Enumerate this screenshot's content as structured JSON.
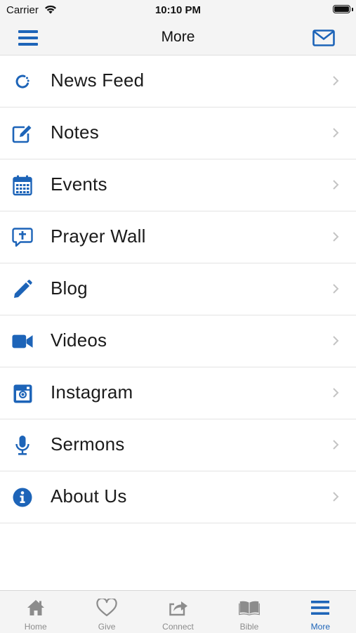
{
  "status_bar": {
    "carrier": "Carrier",
    "time": "10:10 PM"
  },
  "nav": {
    "title": "More",
    "menu_icon": "hamburger-menu-icon",
    "mail_icon": "envelope-icon"
  },
  "colors": {
    "accent": "#1d64b8",
    "tab_inactive": "#8c8c8c",
    "chevron": "#c4c4c4"
  },
  "menu_items": [
    {
      "label": "News Feed",
      "icon": "refresh-icon"
    },
    {
      "label": "Notes",
      "icon": "edit-note-icon"
    },
    {
      "label": "Events",
      "icon": "calendar-icon"
    },
    {
      "label": "Prayer Wall",
      "icon": "chat-cross-icon"
    },
    {
      "label": "Blog",
      "icon": "pencil-icon"
    },
    {
      "label": "Videos",
      "icon": "video-camera-icon"
    },
    {
      "label": "Instagram",
      "icon": "instagram-icon"
    },
    {
      "label": "Sermons",
      "icon": "microphone-icon"
    },
    {
      "label": "About Us",
      "icon": "info-icon"
    }
  ],
  "tabs": [
    {
      "label": "Home",
      "icon": "home-icon",
      "active": false
    },
    {
      "label": "Give",
      "icon": "heart-icon",
      "active": false
    },
    {
      "label": "Connect",
      "icon": "share-icon",
      "active": false
    },
    {
      "label": "Bible",
      "icon": "book-icon",
      "active": false
    },
    {
      "label": "More",
      "icon": "hamburger-menu-icon",
      "active": true
    }
  ]
}
